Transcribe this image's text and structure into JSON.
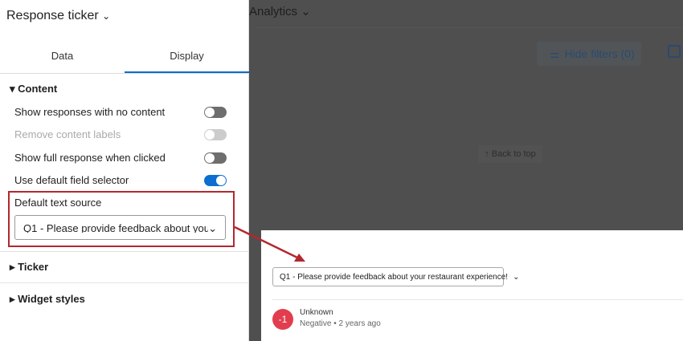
{
  "background": {
    "title": "Analytics",
    "hide_filters": "Hide filters (0)",
    "back_to_top": "↑ Back to top"
  },
  "panel": {
    "title": "Response ticker",
    "tabs": [
      "Data",
      "Display"
    ],
    "content_section": "Content",
    "toggles": [
      {
        "label": "Show responses with no content",
        "on": false,
        "disabled": false
      },
      {
        "label": "Remove content labels",
        "on": false,
        "disabled": true
      },
      {
        "label": "Show full response when clicked",
        "on": false,
        "disabled": false
      },
      {
        "label": "Use default field selector",
        "on": true,
        "disabled": false
      }
    ],
    "default_text_source_label": "Default text source",
    "default_text_source_value": "Q1 - Please provide feedback about your restaurant experience!",
    "ticker_section": "Ticker",
    "widget_styles_section": "Widget styles"
  },
  "preview": {
    "selector": "Q1 - Please provide feedback about your restaurant experience!",
    "avatar": "-1",
    "name": "Unknown",
    "meta": "Negative • 2 years ago"
  },
  "colors": {
    "accent": "#0b6ed0",
    "highlight": "#b3282f",
    "negative": "#e23d4e"
  }
}
